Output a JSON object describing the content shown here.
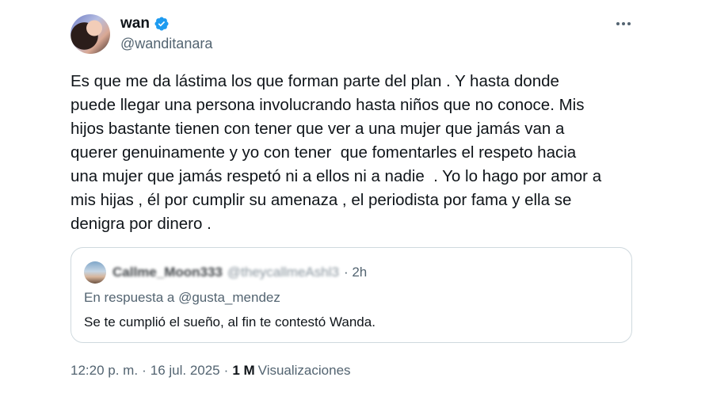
{
  "author": {
    "name": "wan",
    "handle": "@wanditanara",
    "verified_color": "#1d9bf0"
  },
  "tweet": {
    "text": "Es que me da lástima los que forman parte del plan . Y hasta donde\npuede llegar una persona involucrando hasta niños que no conoce. Mis\nhijos bastante tienen con tener que ver a una mujer que jamás van a\nquerer genuinamente y yo con tener  que fomentarles el respeto hacia\nuna mujer que jamás respetó ni a ellos ni a nadie  . Yo lo hago por amor a\nmis hijas , él por cumplir su amenaza , el periodista por fama y ella se\ndenigra por dinero ."
  },
  "quoted": {
    "name": "Callme_Moon333",
    "handle": "@theycallmeAshl3",
    "time": "· 2h",
    "reply_prefix": "En respuesta a",
    "reply_to": "@gusta_mendez",
    "text": "Se te cumplió el sueño, al fin te contestó Wanda."
  },
  "meta": {
    "time": "12:20 p. m.",
    "sep": "·",
    "date": "16 jul. 2025",
    "views_count": "1 M",
    "views_label": "Visualizaciones"
  },
  "icons": {
    "more": "more-dots-icon",
    "verified": "verified-badge-icon"
  }
}
